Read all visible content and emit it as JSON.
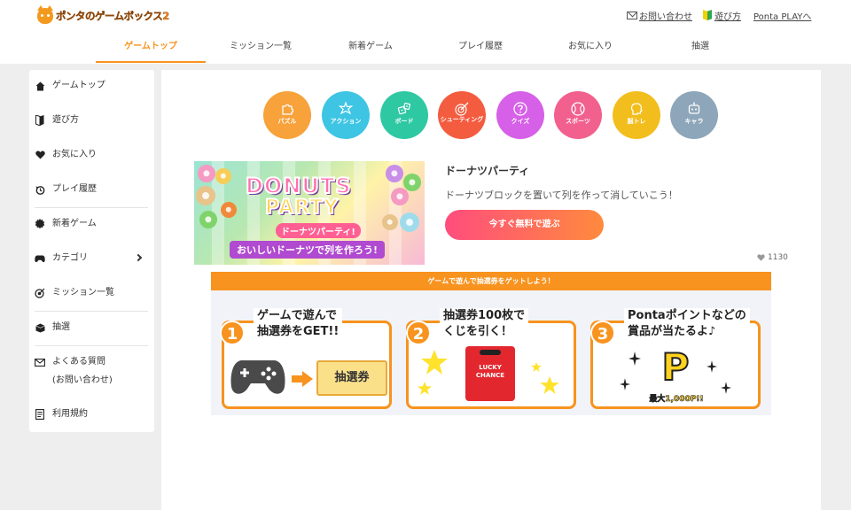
{
  "header": {
    "logo_text": "ポンタのゲームボックス2",
    "contact_link": "お問い合わせ",
    "howto_link": "遊び方",
    "ponta_play_link": "Ponta PLAYへ"
  },
  "nav": {
    "tabs": [
      {
        "label": "ゲームトップ",
        "active": true
      },
      {
        "label": "ミッション一覧"
      },
      {
        "label": "新着ゲーム"
      },
      {
        "label": "プレイ履歴"
      },
      {
        "label": "お気に入り"
      },
      {
        "label": "抽選"
      }
    ]
  },
  "sidebar": {
    "items": [
      {
        "label": "ゲームトップ",
        "icon": "home-icon"
      },
      {
        "label": "遊び方",
        "icon": "beginner-mark-icon"
      },
      {
        "label": "お気に入り",
        "icon": "heart-icon"
      },
      {
        "label": "プレイ履歴",
        "icon": "history-icon"
      },
      {
        "label": "新着ゲーム",
        "icon": "new-badge-icon"
      },
      {
        "label": "カテゴリ",
        "icon": "gamepad-icon"
      },
      {
        "label": "ミッション一覧",
        "icon": "target-icon"
      },
      {
        "label": "抽選",
        "icon": "lottery-box-icon"
      },
      {
        "label": "よくある質問",
        "label2": "(お問い合わせ)",
        "icon": "mail-icon"
      },
      {
        "label": "利用規約",
        "icon": "document-icon"
      }
    ]
  },
  "categories": [
    {
      "label": "パズル",
      "color": "#f7a23a",
      "icon": "puzzle-icon"
    },
    {
      "label": "アクション",
      "color": "#3dc5e3",
      "icon": "action-icon"
    },
    {
      "label": "ボード",
      "color": "#2ec8a3",
      "icon": "board-icon"
    },
    {
      "label": "シューティング",
      "color": "#f45c3f",
      "icon": "target-icon"
    },
    {
      "label": "クイズ",
      "color": "#d660e8",
      "icon": "quiz-icon"
    },
    {
      "label": "スポーツ",
      "color": "#f2608e",
      "icon": "sports-icon"
    },
    {
      "label": "脳トレ",
      "color": "#f2be1e",
      "icon": "brain-icon"
    },
    {
      "label": "キャラ",
      "color": "#8ea6b9",
      "icon": "character-icon"
    }
  ],
  "featured": {
    "banner_title_1": "DONUTS",
    "banner_title_2": "PARTY",
    "banner_subtitle": "ドーナツパーティ!",
    "banner_tagline": "おいしいドーナツで列を作ろう!",
    "title": "ドーナツパーティ",
    "description": "ドーナツブロックを置いて列を作って消していこう！",
    "play_button": "今すぐ無料で遊ぶ",
    "likes": "1130"
  },
  "lottery": {
    "header": "ゲームで遊んで抽選券をゲットしよう！",
    "steps": [
      {
        "num": "1",
        "line1": "ゲームで遊んで",
        "line2": "抽選券をGET!!",
        "ticket": "抽選券"
      },
      {
        "num": "2",
        "line1": "抽選券100枚で",
        "line2": "くじを引く！",
        "box_text": "LUCKY CHANCE"
      },
      {
        "num": "3",
        "line1": "Pontaポイントなどの",
        "line2": "賞品が当たるよ♪",
        "prize": "最大1,000P!!",
        "letter": "P"
      }
    ]
  },
  "colors": {
    "accent": "#f7931e",
    "play_gradient_start": "#ff4d7d",
    "play_gradient_end": "#ff8a3d"
  }
}
